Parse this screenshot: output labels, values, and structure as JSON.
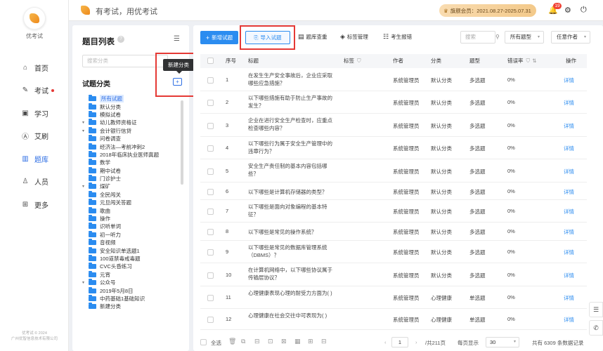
{
  "app": {
    "name": "优考试",
    "header_title": "有考试，用优考试",
    "copyright_line1": "优考试 © 2024",
    "copyright_line2": "广州优智信息技术有限公司"
  },
  "header": {
    "vip_label": "旗舰会员：2021.08.27-2025.07.31",
    "notification_count": "19"
  },
  "nav": [
    {
      "label": "首页",
      "icon": "home-icon",
      "glyph": "⌂"
    },
    {
      "label": "考试",
      "icon": "exam-icon",
      "glyph": "✎"
    },
    {
      "label": "学习",
      "icon": "study-icon",
      "glyph": "▣"
    },
    {
      "label": "艾刷",
      "icon": "practice-icon",
      "glyph": "Ⓐ"
    },
    {
      "label": "题库",
      "icon": "question-bank-icon",
      "glyph": "▥"
    },
    {
      "label": "人员",
      "icon": "people-icon",
      "glyph": "♙"
    },
    {
      "label": "更多",
      "icon": "more-icon",
      "glyph": "⊞"
    }
  ],
  "tree_panel": {
    "title": "题目列表",
    "search_placeholder": "搜索分类",
    "category_title": "试题分类",
    "new_category_tooltip": "新建分类",
    "nodes": [
      {
        "label": "所有试题",
        "level": 0,
        "arrow": "",
        "selected": true
      },
      {
        "label": "默认分类",
        "level": 0,
        "arrow": ""
      },
      {
        "label": "模拟试卷",
        "level": 0,
        "arrow": ""
      },
      {
        "label": "幼儿教师资格证",
        "level": 0,
        "arrow": "▾"
      },
      {
        "label": "会计银行信贷",
        "level": 0,
        "arrow": "▾"
      },
      {
        "label": "问卷调查",
        "level": 0,
        "arrow": ""
      },
      {
        "label": "经济法—考前冲刺2",
        "level": 0,
        "arrow": ""
      },
      {
        "label": "2018年临床执业医师真题",
        "level": 0,
        "arrow": ""
      },
      {
        "label": "数学",
        "level": 0,
        "arrow": ""
      },
      {
        "label": "期中试卷",
        "level": 0,
        "arrow": ""
      },
      {
        "label": "门诊护士",
        "level": 0,
        "arrow": ""
      },
      {
        "label": "煤矿",
        "level": 0,
        "arrow": "▾"
      },
      {
        "label": "全民闯关",
        "level": 0,
        "arrow": ""
      },
      {
        "label": "元旦闯关答题",
        "level": 0,
        "arrow": ""
      },
      {
        "label": "歌曲",
        "level": 0,
        "arrow": ""
      },
      {
        "label": "操作",
        "level": 0,
        "arrow": ""
      },
      {
        "label": "识听单词",
        "level": 0,
        "arrow": ""
      },
      {
        "label": "初一听力",
        "level": 0,
        "arrow": ""
      },
      {
        "label": "音视频",
        "level": 0,
        "arrow": ""
      },
      {
        "label": "安全知识单选题1",
        "level": 0,
        "arrow": ""
      },
      {
        "label": "100道禁毒戒毒题",
        "level": 0,
        "arrow": ""
      },
      {
        "label": "CVC头昏练习",
        "level": 0,
        "arrow": ""
      },
      {
        "label": "元宵",
        "level": 0,
        "arrow": ""
      },
      {
        "label": "公众号",
        "level": 0,
        "arrow": "▾"
      },
      {
        "label": "2019年5月8日",
        "level": 0,
        "arrow": ""
      },
      {
        "label": "中药基础1基础知识",
        "level": 0,
        "arrow": ""
      },
      {
        "label": "新建分类",
        "level": 0,
        "arrow": ""
      }
    ]
  },
  "toolbar": {
    "new_question": "新增试题",
    "import_questions": "导入试题",
    "dedupe": "题库查重",
    "tag_manage": "标签管理",
    "student_report": "考生报错",
    "search_placeholder": "搜索",
    "type_select": "所有题型",
    "author_select": "任意作者"
  },
  "table": {
    "headers": {
      "index": "序号",
      "title": "标题",
      "tags": "标签",
      "author": "作者",
      "category": "分类",
      "type": "题型",
      "error_rate": "错误率",
      "action": "操作"
    },
    "rows": [
      {
        "index": "1",
        "title": "在发生生产安全事故后，企业应采取哪些应急措施？",
        "author": "系统管理员",
        "category": "默认分类",
        "type": "多选题",
        "error_rate": "0%",
        "action": "详情"
      },
      {
        "index": "2",
        "title": "以下哪些措施有助于防止生产事故的发生？",
        "author": "系统管理员",
        "category": "默认分类",
        "type": "多选题",
        "error_rate": "0%",
        "action": "详情"
      },
      {
        "index": "3",
        "title": "企业在进行安全生产检查时，应重点检查哪些内容？",
        "author": "系统管理员",
        "category": "默认分类",
        "type": "多选题",
        "error_rate": "0%",
        "action": "详情"
      },
      {
        "index": "4",
        "title": "以下哪些行为属于安全生产管理中的违章行为？",
        "author": "系统管理员",
        "category": "默认分类",
        "type": "多选题",
        "error_rate": "0%",
        "action": "详情"
      },
      {
        "index": "5",
        "title": "安全生产责任制的基本内容包括哪些？",
        "author": "系统管理员",
        "category": "默认分类",
        "type": "多选题",
        "error_rate": "0%",
        "action": "详情"
      },
      {
        "index": "6",
        "title": "以下哪些是计算机存储器的类型？",
        "author": "系统管理员",
        "category": "默认分类",
        "type": "多选题",
        "error_rate": "0%",
        "action": "详情"
      },
      {
        "index": "7",
        "title": "以下哪些是面向对象编程的基本特征？",
        "author": "系统管理员",
        "category": "默认分类",
        "type": "多选题",
        "error_rate": "0%",
        "action": "详情"
      },
      {
        "index": "8",
        "title": "以下哪些是常见的操作系统？",
        "author": "系统管理员",
        "category": "默认分类",
        "type": "多选题",
        "error_rate": "0%",
        "action": "详情"
      },
      {
        "index": "9",
        "title": "以下哪些是常见的数据库管理系统（DBMS）？",
        "author": "系统管理员",
        "category": "默认分类",
        "type": "多选题",
        "error_rate": "0%",
        "action": "详情"
      },
      {
        "index": "10",
        "title": "在计算机网络中，以下哪些协议属于传输层协议？",
        "author": "系统管理员",
        "category": "默认分类",
        "type": "多选题",
        "error_rate": "0%",
        "action": "详情"
      },
      {
        "index": "11",
        "title": "心理健康表现心理的耐受力方面为( )",
        "author": "系统管理员",
        "category": "心理健康",
        "type": "单选题",
        "error_rate": "0%",
        "action": "详情"
      },
      {
        "index": "12",
        "title": "心理健康在社会交往中可表现为( )",
        "author": "系统管理员",
        "category": "心理健康",
        "type": "单选题",
        "error_rate": "0%",
        "action": "详情"
      }
    ]
  },
  "footer": {
    "select_all": "全选",
    "current_page": "1",
    "total_pages": "/共211页",
    "per_page_label": "每页显示",
    "per_page": "30",
    "total_records": "共有 6309 条数据记录"
  }
}
